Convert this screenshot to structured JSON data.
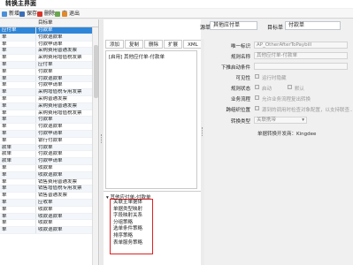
{
  "window": {
    "title": "转换主界面"
  },
  "toolbar": {
    "new_label": "新增",
    "save_label": "保存",
    "delete_label": "删除",
    "search_label": "查",
    "exit_label": "退出"
  },
  "left_table": {
    "headers": [
      "",
      "目标单"
    ],
    "rows": [
      {
        "c1": "应付单",
        "c2": "付款单",
        "sel": true
      },
      {
        "c1": "单",
        "c2": "付款退款单"
      },
      {
        "c1": "单",
        "c2": "付款申请单"
      },
      {
        "c1": "单",
        "c2": "采购费用普通发票"
      },
      {
        "c1": "单",
        "c2": "采购费用增值税发票"
      },
      {
        "c1": "单",
        "c2": "应付单"
      },
      {
        "c1": "单",
        "c2": "付款单"
      },
      {
        "c1": "单",
        "c2": "付款退款单"
      },
      {
        "c1": "单",
        "c2": "付款申请单"
      },
      {
        "c1": "单",
        "c2": "采购增值税专用发票"
      },
      {
        "c1": "单",
        "c2": "采购普通发票"
      },
      {
        "c1": "单",
        "c2": "采购费用普通发票"
      },
      {
        "c1": "单",
        "c2": "采购费用增值税发票"
      },
      {
        "c1": "单",
        "c2": "付款单"
      },
      {
        "c1": "单",
        "c2": "付款退款单"
      },
      {
        "c1": "单",
        "c2": "付款申请单"
      },
      {
        "c1": "单",
        "c2": "银行付款单"
      },
      {
        "c1": "款单",
        "c2": "付款单"
      },
      {
        "c1": "款单",
        "c2": "付款退款单"
      },
      {
        "c1": "款单",
        "c2": "付款申请单"
      },
      {
        "c1": "单",
        "c2": "收款单"
      },
      {
        "c1": "单",
        "c2": "收款退款单"
      },
      {
        "c1": "单",
        "c2": "销售费用普通发票"
      },
      {
        "c1": "单",
        "c2": "销售增值税专用发票"
      },
      {
        "c1": "单",
        "c2": "销售普通发票"
      },
      {
        "c1": "单",
        "c2": "应收单"
      },
      {
        "c1": "单",
        "c2": "收款单"
      },
      {
        "c1": "单",
        "c2": "收款退款单"
      },
      {
        "c1": "单",
        "c2": "收款单"
      },
      {
        "c1": "单",
        "c2": "收款退款单"
      }
    ]
  },
  "header": {
    "source_label": "源单",
    "source_value": "其他应付单",
    "target_label": "目标单",
    "target_value": "付款单"
  },
  "mid_buttons": [
    "添加",
    "复制",
    "删除",
    "扩展",
    "XML"
  ],
  "rule_item": "[启用] 其他应付单-付款单",
  "lower": {
    "header": "其他应付单-付款单",
    "items": [
      "关联主单据体",
      "单据类型映射",
      "字段映射关系",
      "分组策略",
      "选单条件策略",
      "排序策略",
      "表单服务策略"
    ]
  },
  "form": {
    "fields": [
      {
        "label": "唯一标识",
        "value": "AP_OtherAfterToPaybill"
      },
      {
        "label": "规则名称",
        "value": "其他应付单-付款单"
      },
      {
        "label": "下推启动条件",
        "value": ""
      }
    ],
    "visible_label": "可见性",
    "visible_opt": "运行时隐藏",
    "status_label": "规则状态",
    "status_opt1": "启动",
    "status_opt2": "默认",
    "business_label": "业务流程",
    "business_opt": "允许业务流程复出转换",
    "cross_label": "跨组织位置",
    "cross_opt": "源到的调用时检查对象配置，以支持联查...",
    "type_label": "转换类型",
    "type_value": "关联携带",
    "note": "单据转换开发商：Kingdee"
  }
}
